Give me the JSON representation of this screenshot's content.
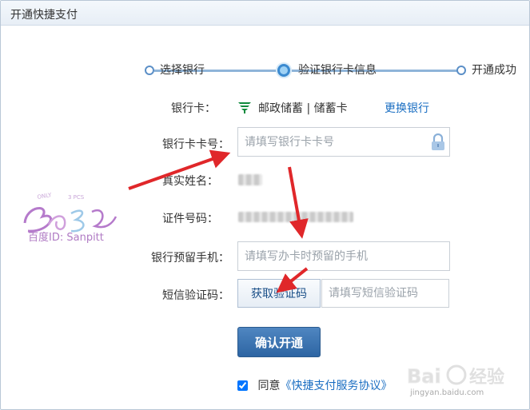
{
  "window": {
    "title": "开通快捷支付"
  },
  "steps": [
    {
      "label": "选择银行",
      "state": "done"
    },
    {
      "label": "验证银行卡信息",
      "state": "active"
    },
    {
      "label": "开通成功",
      "state": "todo"
    }
  ],
  "form": {
    "bank_card": {
      "label": "银行卡：",
      "bank_name": "邮政储蓄 | 储蓄卡",
      "change_link": "更换银行",
      "bank_icon": "postal-bank-logo-icon"
    },
    "card_number": {
      "label": "银行卡卡号：",
      "placeholder": "请填写银行卡卡号",
      "value": ""
    },
    "real_name": {
      "label": "真实姓名：",
      "value_state": "blurred"
    },
    "id_number": {
      "label": "证件号码：",
      "value_state": "blurred"
    },
    "phone": {
      "label": "银行预留手机：",
      "placeholder": "请填写办卡时预留的手机",
      "value": ""
    },
    "sms_code": {
      "label": "短信验证码：",
      "button_label": "获取验证码",
      "placeholder": "请填写短信验证码",
      "value": ""
    },
    "confirm_button": "确认开通",
    "agreement": {
      "checked": true,
      "prefix": "同意",
      "link": "《快捷支付服务协议》"
    }
  },
  "watermark": {
    "text": "百度ID: Sanpitt",
    "baidu": "Bai经验",
    "baidu_sub": "jingyan.baidu.com"
  },
  "colors": {
    "accent": "#1a6ec2",
    "primary_button": "#2d65a3",
    "arrow": "#e0272a",
    "step_line": "#8fb4d9"
  }
}
